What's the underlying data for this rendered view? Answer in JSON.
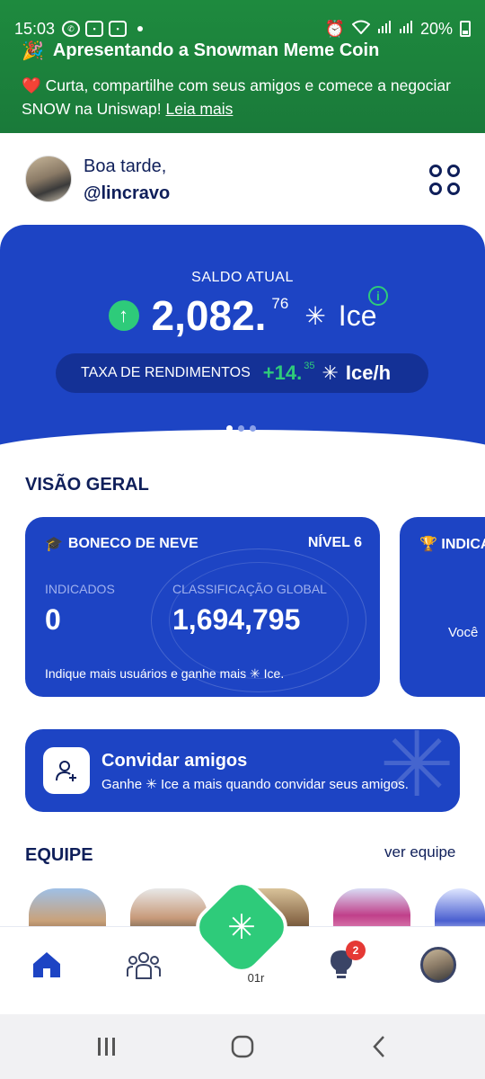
{
  "status_bar": {
    "time": "15:03",
    "battery": "20%"
  },
  "banner": {
    "emoji": "🎉",
    "title": "Apresentando a Snowman Meme Coin",
    "heart": "❤️",
    "text": "Curta, compartilhe com seus amigos e comece a negociar SNOW na Uniswap!",
    "link": "Leia mais"
  },
  "header": {
    "greeting": "Boa tarde,",
    "username": "@lincravo"
  },
  "balance": {
    "label": "SALDO ATUAL",
    "value": "2,082.",
    "decimals": "76",
    "unit": "Ice",
    "rate_label": "TAXA DE RENDIMENTOS",
    "rate_value": "+14.",
    "rate_decimals": "35",
    "rate_unit": "Ice/h"
  },
  "overview": {
    "title": "VISÃO GERAL",
    "card1": {
      "title": "BONECO DE NEVE",
      "level": "NÍVEL 6",
      "referrals_label": "INDICADOS",
      "referrals_value": "0",
      "rank_label": "CLASSIFICAÇÃO GLOBAL",
      "rank_value": "1,694,795",
      "footer": "Indique mais usuários e ganhe mais ✳ Ice."
    },
    "card2": {
      "title": "INDICA",
      "text": "Você"
    }
  },
  "invite": {
    "title": "Convidar amigos",
    "subtitle": "Ganhe ✳ Ice a mais quando convidar seus amigos."
  },
  "team": {
    "title": "EQUIPE",
    "link": "ver equipe"
  },
  "bottom_nav": {
    "notifications_badge": "2",
    "center_label": "01r"
  },
  "colors": {
    "brand_blue": "#1d44c4",
    "accent_green": "#2ecb7a",
    "banner_green": "#1e8a3e",
    "badge_red": "#e53935"
  }
}
